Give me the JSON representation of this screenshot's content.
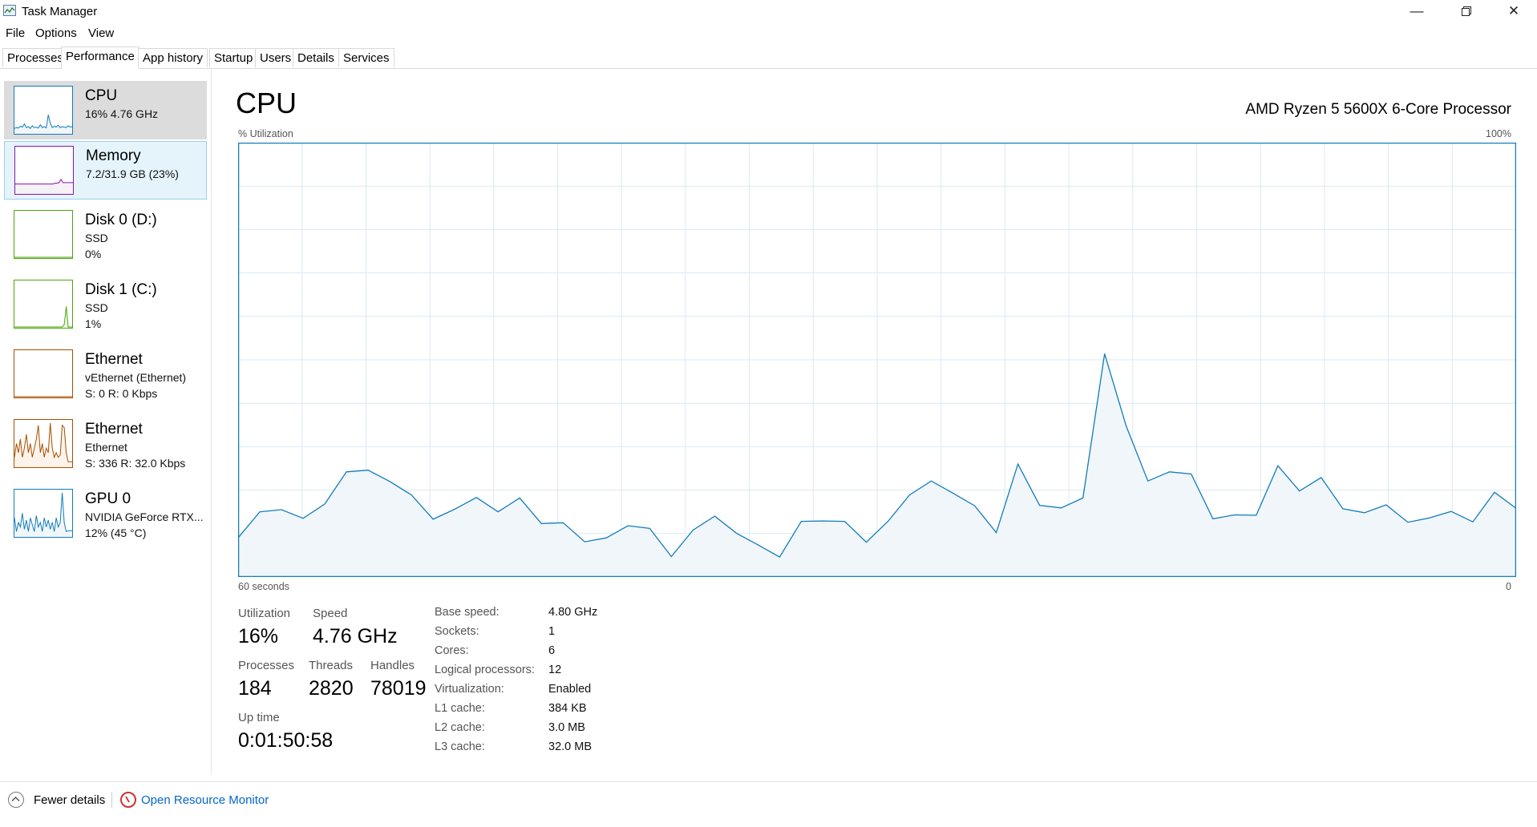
{
  "window": {
    "title": "Task Manager",
    "app_icon": "task-manager-icon",
    "controls": [
      "minimize-icon",
      "restore-icon",
      "close-icon"
    ]
  },
  "menu": [
    "File",
    "Options",
    "View"
  ],
  "tabs": [
    {
      "label": "Processes"
    },
    {
      "label": "Performance",
      "active": true
    },
    {
      "label": "App history"
    },
    {
      "label": "Startup"
    },
    {
      "label": "Users"
    },
    {
      "label": "Details"
    },
    {
      "label": "Services"
    }
  ],
  "sidebar": [
    {
      "name": "CPU",
      "sub1": "16%  4.76 GHz",
      "sub2": "",
      "color": "#117dbb",
      "fill": "#f1f6fa",
      "selected": true,
      "spark": [
        0.1,
        0.12,
        0.11,
        0.15,
        0.13,
        0.2,
        0.12,
        0.14,
        0.1,
        0.16,
        0.12,
        0.13,
        0.11,
        0.18,
        0.12,
        0.14,
        0.11,
        0.4,
        0.22,
        0.12,
        0.15,
        0.13,
        0.17,
        0.12,
        0.14,
        0.13,
        0.12,
        0.16,
        0.13,
        0.14
      ]
    },
    {
      "name": "Memory",
      "sub1": "7.2/31.9 GB (23%)",
      "sub2": "",
      "color": "#8b12ae",
      "fill": "#f4f2f4",
      "hover": true,
      "spark": [
        0.2,
        0.2,
        0.2,
        0.2,
        0.2,
        0.2,
        0.2,
        0.2,
        0.2,
        0.2,
        0.2,
        0.2,
        0.2,
        0.2,
        0.2,
        0.2,
        0.2,
        0.2,
        0.2,
        0.2,
        0.22,
        0.22,
        0.23,
        0.3,
        0.23,
        0.23,
        0.23,
        0.23,
        0.23,
        0.23
      ]
    },
    {
      "name": "Disk 0 (D:)",
      "sub1": "SSD",
      "sub2": "0%",
      "color": "#4da60c",
      "fill": "#eff7e8",
      "spark": [
        0,
        0,
        0,
        0,
        0,
        0,
        0,
        0,
        0,
        0,
        0,
        0,
        0,
        0,
        0,
        0,
        0,
        0,
        0,
        0,
        0,
        0,
        0,
        0,
        0,
        0,
        0,
        0,
        0,
        0
      ]
    },
    {
      "name": "Disk 1 (C:)",
      "sub1": "SSD",
      "sub2": "1%",
      "color": "#4da60c",
      "fill": "#eff7e8",
      "spark": [
        0,
        0,
        0,
        0,
        0,
        0,
        0,
        0,
        0,
        0,
        0,
        0,
        0,
        0,
        0,
        0,
        0,
        0,
        0,
        0,
        0,
        0,
        0,
        0,
        0,
        0.05,
        0.45,
        0,
        0,
        0
      ]
    },
    {
      "name": "Ethernet",
      "sub1": "vEthernet (Ethernet)",
      "sub2": "S: 0  R: 0 Kbps",
      "color": "#a74f01",
      "fill": "#fcf3eb",
      "spark": [
        0,
        0,
        0,
        0,
        0,
        0,
        0,
        0,
        0,
        0,
        0,
        0,
        0,
        0,
        0,
        0,
        0,
        0,
        0,
        0,
        0,
        0,
        0,
        0,
        0,
        0,
        0,
        0,
        0,
        0
      ]
    },
    {
      "name": "Ethernet",
      "sub1": "Ethernet",
      "sub2": "S: 336  R: 32.0 Kbps",
      "color": "#a74f01",
      "fill": "#fcf3eb",
      "spark": [
        0.2,
        0.5,
        0.3,
        0.6,
        0.2,
        0.4,
        0.7,
        0.3,
        0.5,
        0.2,
        0.4,
        0.6,
        0.9,
        0.3,
        0.5,
        0.2,
        0.4,
        0.3,
        0.95,
        0.4,
        0.2,
        0.3,
        0.2,
        0.25,
        0.9,
        0.85,
        0.3,
        0.1,
        0.1,
        0.1
      ]
    },
    {
      "name": "GPU 0",
      "sub1": "NVIDIA GeForce RTX...",
      "sub2": "12%  (45 °C)",
      "color": "#117dbb",
      "fill": "#f1f6fa",
      "spark": [
        0.4,
        0.1,
        0.3,
        0.2,
        0.5,
        0.15,
        0.35,
        0.1,
        0.4,
        0.25,
        0.1,
        0.45,
        0.2,
        0.3,
        0.1,
        0.4,
        0.2,
        0.35,
        0.15,
        0.3,
        0.1,
        0.4,
        0.2,
        0.3,
        0.95,
        0.3,
        0.1,
        0.12,
        0.12,
        0.12
      ]
    }
  ],
  "main": {
    "title": "CPU",
    "model": "AMD Ryzen 5 5600X 6-Core Processor",
    "util_label": "% Utilization",
    "max_label": "100%",
    "time_left": "60 seconds",
    "time_right": "0"
  },
  "chart_data": {
    "type": "area",
    "title": "CPU",
    "ylabel": "% Utilization",
    "xlabel": "60 seconds",
    "ylim": [
      0,
      100
    ],
    "xlim": [
      60,
      0
    ],
    "grid": true,
    "color": "#117dbb",
    "fill": "#f1f6fa",
    "values": [
      9,
      15,
      15.5,
      13.5,
      16.8,
      24.2,
      24.6,
      22,
      18.9,
      13.3,
      15.6,
      18.3,
      15,
      18.2,
      12.3,
      12.5,
      8.1,
      9,
      11.8,
      11.2,
      4.7,
      10.8,
      14,
      10.1,
      7.4,
      4.6,
      12.8,
      12.9,
      12.8,
      8,
      12.8,
      18.9,
      22.1,
      19.3,
      16.4,
      10.2,
      26,
      16.5,
      15.9,
      18.2,
      51.4,
      34.7,
      22.1,
      24.2,
      23.7,
      13.4,
      14.3,
      14.2,
      25.6,
      19.8,
      22.9,
      15.7,
      14.8,
      16.6,
      12.6,
      13.6,
      15.1,
      12.7,
      19.5,
      15.8
    ]
  },
  "stats": {
    "utilization": {
      "label": "Utilization",
      "value": "16%"
    },
    "speed": {
      "label": "Speed",
      "value": "4.76 GHz"
    },
    "processes": {
      "label": "Processes",
      "value": "184"
    },
    "threads": {
      "label": "Threads",
      "value": "2820"
    },
    "handles": {
      "label": "Handles",
      "value": "78019"
    },
    "uptime": {
      "label": "Up time",
      "value": "0:01:50:58"
    }
  },
  "info": [
    {
      "label": "Base speed:",
      "value": "4.80 GHz"
    },
    {
      "label": "Sockets:",
      "value": "1"
    },
    {
      "label": "Cores:",
      "value": "6"
    },
    {
      "label": "Logical processors:",
      "value": "12"
    },
    {
      "label": "Virtualization:",
      "value": "Enabled"
    },
    {
      "label": "L1 cache:",
      "value": "384 KB"
    },
    {
      "label": "L2 cache:",
      "value": "3.0 MB"
    },
    {
      "label": "L3 cache:",
      "value": "32.0 MB"
    }
  ],
  "footer": {
    "fewer": "Fewer details",
    "resource": "Open Resource Monitor"
  }
}
